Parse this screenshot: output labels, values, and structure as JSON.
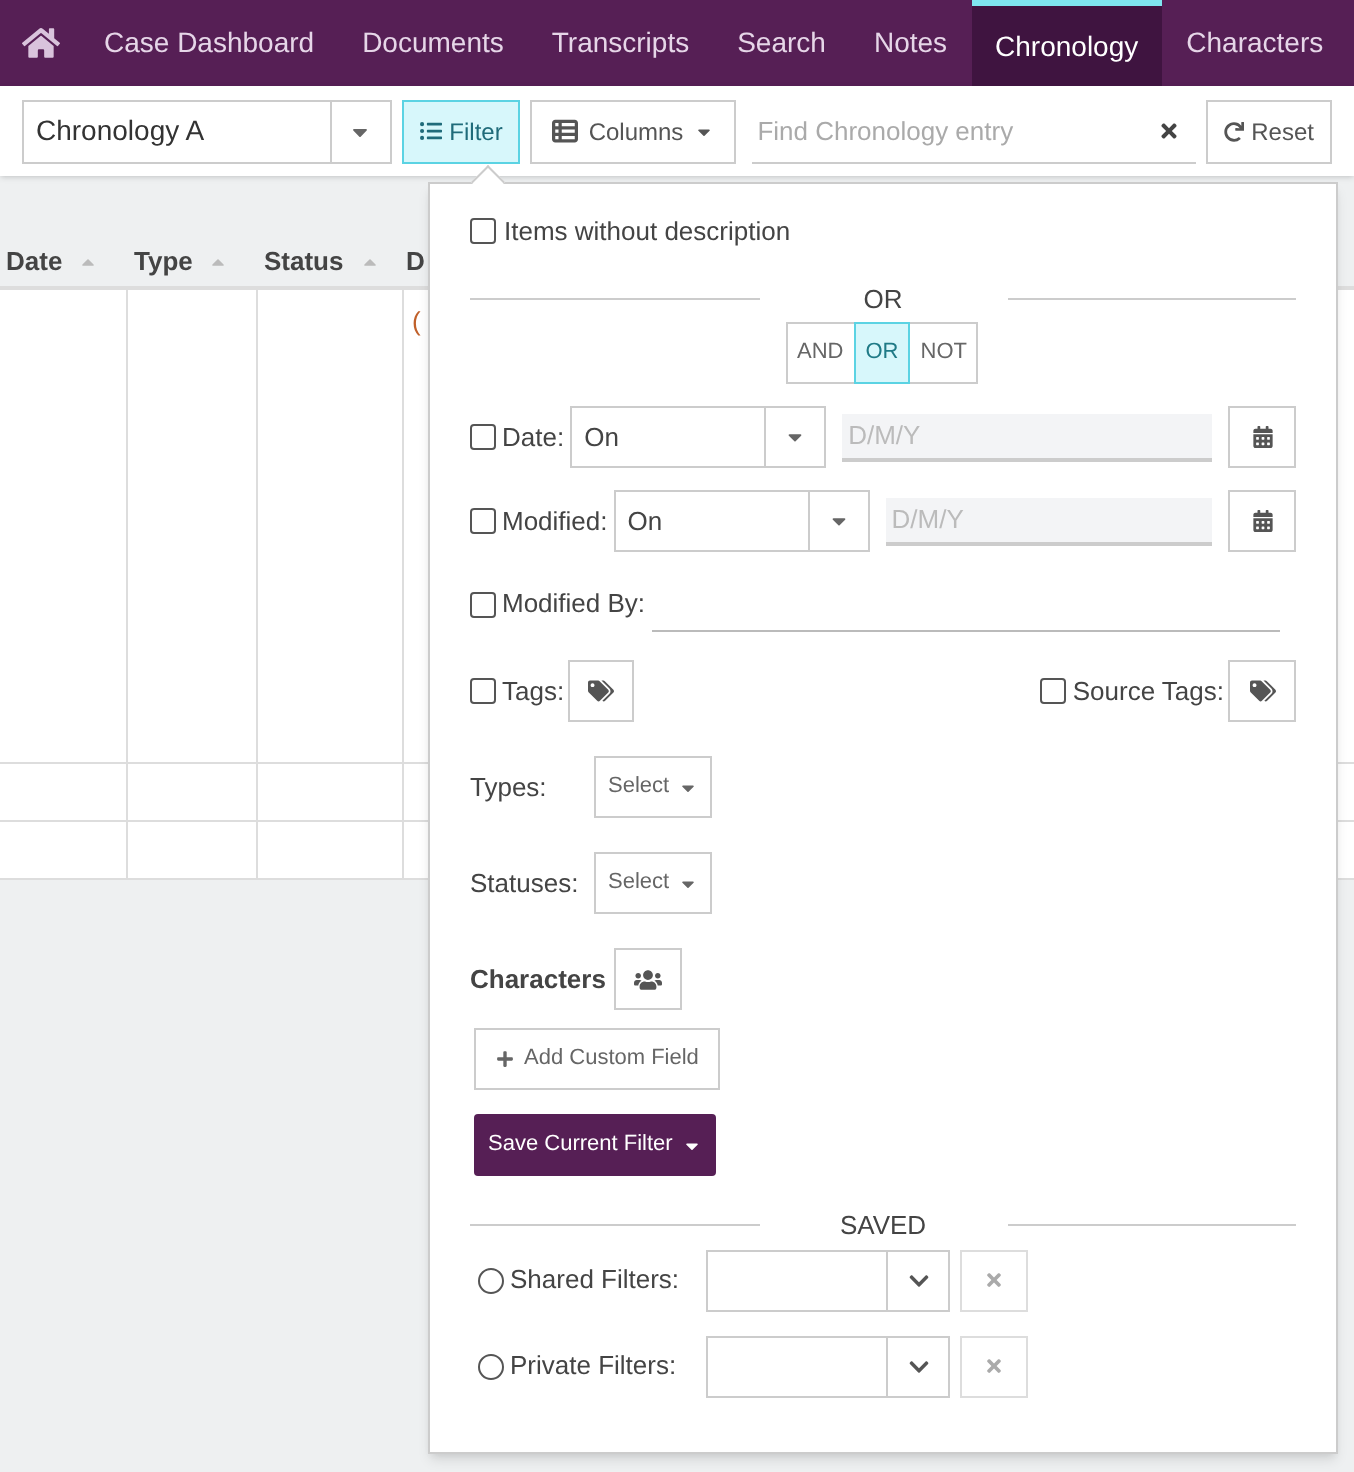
{
  "nav": {
    "tabs": [
      {
        "label": "Case Dashboard",
        "selected": false
      },
      {
        "label": "Documents",
        "selected": false
      },
      {
        "label": "Transcripts",
        "selected": false
      },
      {
        "label": "Search",
        "selected": false
      },
      {
        "label": "Notes",
        "selected": false
      },
      {
        "label": "Chronology",
        "selected": true
      },
      {
        "label": "Characters",
        "selected": false
      }
    ]
  },
  "toolbar": {
    "chronology_select": {
      "value": "Chronology A"
    },
    "filter_button": {
      "label": "Filter",
      "active": true
    },
    "columns_button": {
      "label": "Columns"
    },
    "search": {
      "placeholder": "Find Chronology entry"
    },
    "reset_button": {
      "label": "Reset"
    }
  },
  "table": {
    "columns": [
      {
        "label": "Date"
      },
      {
        "label": "Type"
      },
      {
        "label": "Status"
      },
      {
        "label": "D"
      }
    ],
    "column_4_fragment": "("
  },
  "filter_panel": {
    "without_description": {
      "label": "Items without description",
      "checked": false
    },
    "logic": {
      "heading": "OR",
      "options": [
        {
          "label": "AND",
          "selected": false
        },
        {
          "label": "OR",
          "selected": true
        },
        {
          "label": "NOT",
          "selected": false
        }
      ]
    },
    "date_filters": [
      {
        "label": "Date:",
        "checked": false,
        "operator": "On",
        "placeholder": "D/M/Y"
      },
      {
        "label": "Modified:",
        "checked": false,
        "operator": "On",
        "placeholder": "D/M/Y"
      }
    ],
    "modified_by": {
      "label": "Modified By:",
      "checked": false
    },
    "tags": {
      "label": "Tags:",
      "checked": false
    },
    "source_tags": {
      "label": "Source Tags:",
      "checked": false
    },
    "pickers": [
      {
        "label": "Types:",
        "button": "Select"
      },
      {
        "label": "Statuses:",
        "button": "Select"
      }
    ],
    "characters": {
      "label": "Characters"
    },
    "add_custom_field": "Add Custom Field",
    "save_filter": "Save Current Filter",
    "saved": {
      "heading": "SAVED",
      "options": [
        {
          "label": "Shared Filters:",
          "selected": false
        },
        {
          "label": "Private Filters:",
          "selected": false
        }
      ]
    }
  }
}
